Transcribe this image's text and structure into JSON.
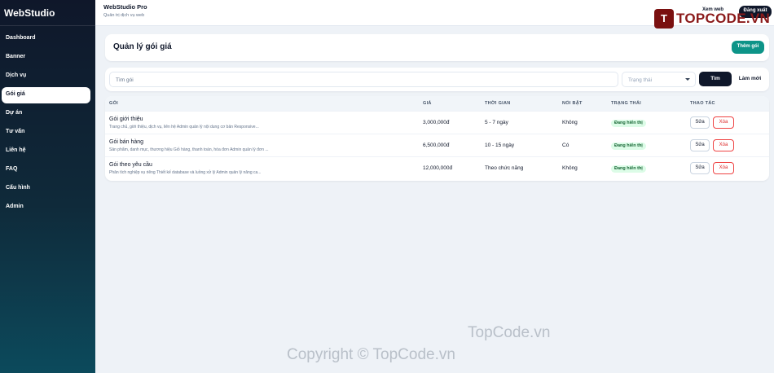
{
  "sidebar": {
    "brand": "WebStudio",
    "items": [
      {
        "label": "Dashboard"
      },
      {
        "label": "Banner"
      },
      {
        "label": "Dịch vụ"
      },
      {
        "label": "Gói giá"
      },
      {
        "label": "Dự án"
      },
      {
        "label": "Tư vấn"
      },
      {
        "label": "Liên hệ"
      },
      {
        "label": "FAQ"
      },
      {
        "label": "Cấu hình"
      },
      {
        "label": "Admin"
      }
    ],
    "active_index": 3
  },
  "topbar": {
    "title": "WebStudio Pro",
    "subtitle": "Quản trị dịch vụ web",
    "view_web": "Xem web",
    "logout": "Đăng xuất",
    "logo_text": "TOPCODE.VN",
    "logo_glyph": "T"
  },
  "header": {
    "title": "Quản lý gói giá",
    "add_button": "Thêm gói"
  },
  "filters": {
    "search_placeholder": "Tìm gói",
    "status_placeholder": "Trạng thái",
    "search_button": "Tìm",
    "reset_button": "Làm mới"
  },
  "table": {
    "columns": [
      "GÓI",
      "GIÁ",
      "THỜI GIAN",
      "NỔI BẬT",
      "TRẠNG THÁI",
      "THAO TÁC"
    ],
    "rows": [
      {
        "name": "Gói giới thiệu",
        "desc": "Trang chủ, giới thiệu, dịch vụ, liên hệ Admin quản lý nội dung cơ bản Responsive...",
        "price": "3,000,000đ",
        "time": "5 - 7 ngày",
        "featured": "Không",
        "status": "Đang hiển thị",
        "edit": "Sửa",
        "delete": "Xóa"
      },
      {
        "name": "Gói bán hàng",
        "desc": "Sản phẩm, danh mục, thương hiệu Giỏ hàng, thanh toán, hóa đơn Admin quản lý đơn ...",
        "price": "6,500,000đ",
        "time": "10 - 15 ngày",
        "featured": "Có",
        "status": "Đang hiển thị",
        "edit": "Sửa",
        "delete": "Xóa"
      },
      {
        "name": "Gói theo yêu cầu",
        "desc": "Phân tích nghiệp vụ riêng Thiết kế database và luồng xử lý Admin quản lý nâng ca...",
        "price": "12,000,000đ",
        "time": "Theo chức năng",
        "featured": "Không",
        "status": "Đang hiển thị",
        "edit": "Sửa",
        "delete": "Xóa"
      }
    ]
  },
  "watermarks": [
    "TopCode.vn",
    "Copyright © TopCode.vn"
  ]
}
